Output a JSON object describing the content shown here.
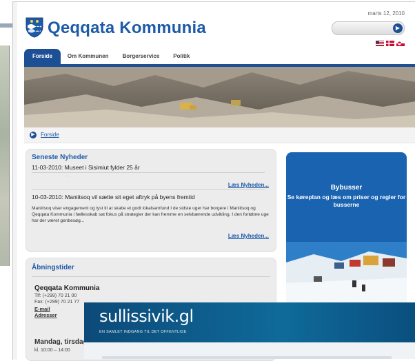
{
  "header": {
    "site_title": "Qeqqata Kommunia",
    "date": "marts 12, 2010"
  },
  "nav": {
    "tabs": [
      {
        "label": "Forside",
        "active": true
      },
      {
        "label": "Om Kommunen",
        "active": false
      },
      {
        "label": "Borgerservice",
        "active": false
      },
      {
        "label": "Politik",
        "active": false
      }
    ]
  },
  "breadcrumb": {
    "link": "Forside"
  },
  "news": {
    "title": "Seneste Nyheder",
    "items": [
      {
        "headline": "11-03-2010: Museet i Sisimiut fylder 25 år"
      },
      {
        "headline": "10-03-2010: Maniitsoq vil sætte sit eget aftryk på byens fremtid"
      }
    ],
    "more_label": "Læs Nyheden...",
    "body": "Maniitsoq viser engagement og lyst til at skabe et godt lokalsamfund I de sidste uger har borgere i Maniitsoq og Qeqqata Kommunia i fællesskab sat fokus på strategier der kan fremme en selvbærende udvikling. I den forløbne uge har der været genbesøg..."
  },
  "hours": {
    "title": "Åbningstider",
    "org": "Qeqqata Kommunia",
    "phone": "Tlf: (+299) 70 21 00",
    "fax": "Fax: (+299) 70 21 77",
    "email": "E-mail",
    "addresses": "Adresser",
    "days": "Mandag, tirsdag",
    "time": "kl. 10:00 – 14:00"
  },
  "bus": {
    "title": "Bybusser",
    "subtitle": "Se køreplan og læs om priser og regler for busserne"
  },
  "overlay": {
    "title": "sullissivik.gl",
    "subtitle": "EN SAMLET INDGANG TIL DET OFFENTLIGE"
  },
  "colors": {
    "brand_blue": "#1d4f95",
    "link_blue": "#1d5aa8",
    "overlay_teal": "#0f6a9a"
  },
  "icons": {
    "search_button": "arrow-right-icon",
    "breadcrumb": "arrow-right-icon",
    "logo": "shield-icon"
  }
}
